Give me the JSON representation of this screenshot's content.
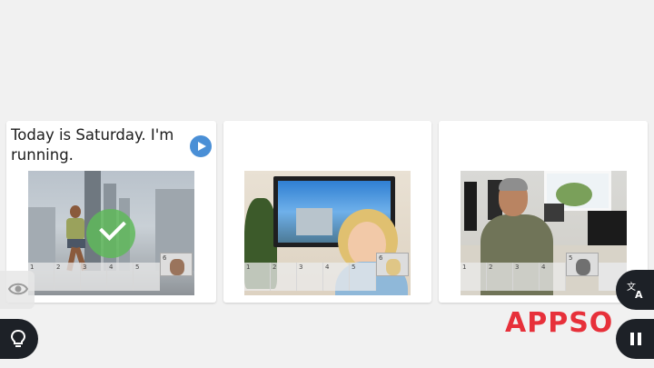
{
  "cards": [
    {
      "caption": "Today is Saturday. I'm running.",
      "has_audio": true,
      "photo": "man-running-photo",
      "answer_state": "correct",
      "frames": [
        "1",
        "2",
        "3",
        "4",
        "5",
        "6"
      ],
      "active_frame": "6"
    },
    {
      "caption": "",
      "has_audio": false,
      "photo": "woman-watching-tv-photo",
      "frames": [
        "1",
        "2",
        "3",
        "4",
        "5",
        "6"
      ],
      "active_frame": "6"
    },
    {
      "caption": "",
      "has_audio": false,
      "photo": "man-at-computer-photo",
      "frames": [
        "1",
        "2",
        "3",
        "4",
        "5"
      ],
      "active_frame": "5"
    }
  ],
  "controls": {
    "visibility_icon": "eye-icon",
    "hint_icon": "lightbulb-icon",
    "translate_icon": "translate-icon",
    "pause_icon": "pause-icon",
    "audio_icon": "play-icon"
  },
  "brand": {
    "logo_text": "APPSO",
    "logo_color": "#e7303a"
  },
  "colors": {
    "background": "#f1f1f1",
    "accent_blue": "#4a8fd6",
    "correct_green": "#5fb95a",
    "button_dark": "#1d2127"
  }
}
